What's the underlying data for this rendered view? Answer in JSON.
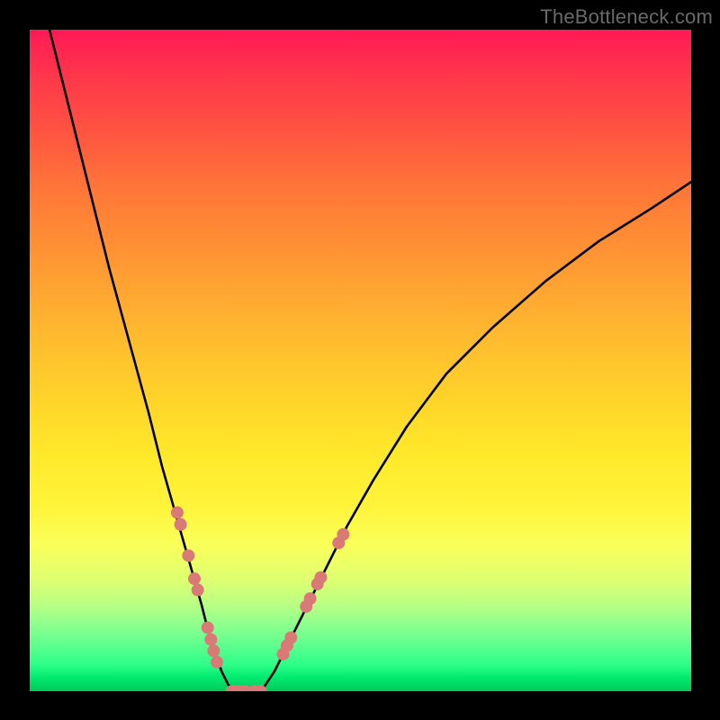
{
  "watermark": "TheBottleneck.com",
  "chart_data": {
    "type": "line",
    "title": "",
    "xlabel": "",
    "ylabel": "",
    "xlim": [
      0,
      100
    ],
    "ylim": [
      0,
      100
    ],
    "grid": false,
    "legend": false,
    "series": [
      {
        "name": "left-limb",
        "color": "#000000",
        "x": [
          3,
          6,
          9,
          12,
          15,
          18,
          20,
          22,
          24,
          26,
          27,
          28,
          29,
          30,
          31
        ],
        "y": [
          100,
          88,
          76,
          64,
          53,
          42,
          34,
          27,
          20,
          13,
          9,
          6,
          3,
          1,
          0
        ]
      },
      {
        "name": "valley-floor",
        "color": "#000000",
        "x": [
          31,
          33,
          35
        ],
        "y": [
          0,
          0,
          0
        ]
      },
      {
        "name": "right-limb",
        "color": "#000000",
        "x": [
          35,
          37,
          40,
          44,
          48,
          52,
          57,
          63,
          70,
          78,
          86,
          94,
          100
        ],
        "y": [
          0,
          3,
          9,
          17,
          25,
          32,
          40,
          48,
          55,
          62,
          68,
          73,
          77
        ]
      }
    ],
    "markers": {
      "name": "highlight-dots",
      "color": "#d97a76",
      "approx_radius_px": 7,
      "points": [
        {
          "x": 22.3,
          "y": 27.0
        },
        {
          "x": 22.8,
          "y": 25.2
        },
        {
          "x": 24.0,
          "y": 20.5
        },
        {
          "x": 24.9,
          "y": 17.0
        },
        {
          "x": 25.4,
          "y": 15.3
        },
        {
          "x": 26.9,
          "y": 9.6
        },
        {
          "x": 27.4,
          "y": 7.8
        },
        {
          "x": 27.8,
          "y": 6.1
        },
        {
          "x": 28.3,
          "y": 4.4
        },
        {
          "x": 30.6,
          "y": 0.0
        },
        {
          "x": 31.5,
          "y": 0.0
        },
        {
          "x": 32.5,
          "y": 0.0
        },
        {
          "x": 33.9,
          "y": 0.0
        },
        {
          "x": 34.9,
          "y": 0.0
        },
        {
          "x": 38.3,
          "y": 5.6
        },
        {
          "x": 38.9,
          "y": 6.9
        },
        {
          "x": 39.5,
          "y": 8.1
        },
        {
          "x": 41.8,
          "y": 12.8
        },
        {
          "x": 42.4,
          "y": 14.0
        },
        {
          "x": 43.5,
          "y": 16.2
        },
        {
          "x": 44.0,
          "y": 17.2
        },
        {
          "x": 46.7,
          "y": 22.4
        },
        {
          "x": 47.4,
          "y": 23.7
        }
      ]
    },
    "background_gradient": {
      "top": "#ff1a55",
      "mid": "#ffd42a",
      "bottom": "#00c95a"
    }
  }
}
